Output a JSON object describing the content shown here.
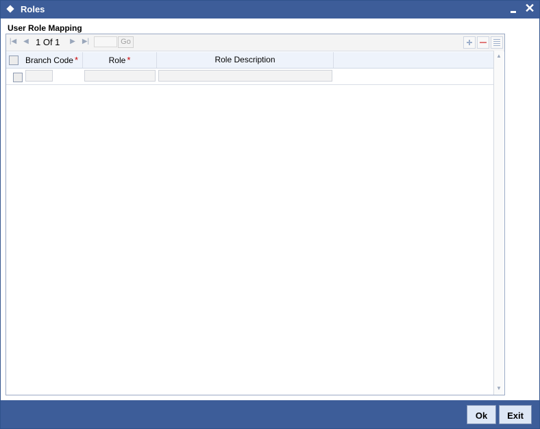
{
  "window": {
    "title": "Roles",
    "close_glyph": "✕"
  },
  "section": {
    "title": "User Role Mapping"
  },
  "grid": {
    "pagination": {
      "text": "1 Of 1",
      "go_label": "Go",
      "page_input_value": ""
    },
    "columns": [
      {
        "label": "Branch Code",
        "required": true
      },
      {
        "label": "Role",
        "required": true
      },
      {
        "label": "Role Description",
        "required": false
      }
    ],
    "required_marker": "*",
    "rows": [
      {
        "branch_code": "",
        "role": "",
        "role_description": ""
      }
    ]
  },
  "footer": {
    "ok_label": "Ok",
    "exit_label": "Exit"
  },
  "icons": {
    "title": "diamond-icon",
    "minimize": "minimize-icon",
    "close": "close-icon",
    "first": "first-page-icon",
    "prev": "previous-page-icon",
    "next": "next-page-icon",
    "last": "last-page-icon",
    "add": "add-row-icon",
    "delete": "delete-row-icon",
    "view": "view-rows-icon",
    "scroll_up": "scroll-up-icon",
    "scroll_down": "scroll-down-icon"
  },
  "colors": {
    "titlebar": "#3d5d99",
    "footer": "#3d5d99",
    "required": "#cc0000",
    "button_bg": "#dde7f6"
  }
}
